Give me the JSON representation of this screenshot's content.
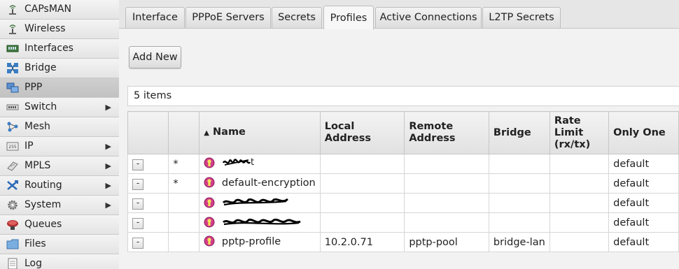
{
  "sidebar": {
    "items": [
      {
        "label": "CAPsMAN",
        "icon": "capsman-icon",
        "arrow": ""
      },
      {
        "label": "Wireless",
        "icon": "wireless-icon",
        "arrow": ""
      },
      {
        "label": "Interfaces",
        "icon": "interfaces-icon",
        "arrow": ""
      },
      {
        "label": "Bridge",
        "icon": "bridge-icon",
        "arrow": ""
      },
      {
        "label": "PPP",
        "icon": "ppp-icon",
        "arrow": ""
      },
      {
        "label": "Switch",
        "icon": "switch-icon",
        "arrow": "▶"
      },
      {
        "label": "Mesh",
        "icon": "mesh-icon",
        "arrow": ""
      },
      {
        "label": "IP",
        "icon": "ip-icon",
        "arrow": "▶"
      },
      {
        "label": "MPLS",
        "icon": "mpls-icon",
        "arrow": "▶"
      },
      {
        "label": "Routing",
        "icon": "routing-icon",
        "arrow": "▶"
      },
      {
        "label": "System",
        "icon": "system-icon",
        "arrow": "▶"
      },
      {
        "label": "Queues",
        "icon": "queues-icon",
        "arrow": ""
      },
      {
        "label": "Files",
        "icon": "files-icon",
        "arrow": ""
      },
      {
        "label": "Log",
        "icon": "log-icon",
        "arrow": ""
      }
    ],
    "active": "PPP"
  },
  "tabs": {
    "items": [
      "Interface",
      "PPPoE Servers",
      "Secrets",
      "Profiles",
      "Active Connections",
      "L2TP Secrets"
    ],
    "active": "Profiles"
  },
  "toolbar": {
    "add_new_label": "Add New"
  },
  "list": {
    "count_label": "5 items"
  },
  "table": {
    "headers": {
      "name": "Name",
      "sort_indicator": "▲",
      "local_address": "Local Address",
      "remote_address": "Remote Address",
      "bridge": "Bridge",
      "rate_limit": "Rate Limit (rx/tx)",
      "only_one": "Only One"
    },
    "rows": [
      {
        "btn": "-",
        "flag": "*",
        "name": "",
        "name_redacted": true,
        "local_address": "",
        "remote_address": "",
        "bridge": "",
        "rate_limit": "",
        "only_one": "default"
      },
      {
        "btn": "-",
        "flag": "*",
        "name": "default-encryption",
        "name_redacted": false,
        "local_address": "",
        "remote_address": "",
        "bridge": "",
        "rate_limit": "",
        "only_one": "default"
      },
      {
        "btn": "-",
        "flag": "",
        "name": "",
        "name_redacted": true,
        "local_address": "",
        "remote_address": "",
        "bridge": "",
        "rate_limit": "",
        "only_one": "default"
      },
      {
        "btn": "-",
        "flag": "",
        "name": "",
        "name_redacted": true,
        "local_address": "",
        "remote_address": "",
        "bridge": "",
        "rate_limit": "",
        "only_one": "default"
      },
      {
        "btn": "-",
        "flag": "",
        "name": "pptp-profile",
        "name_redacted": false,
        "local_address": "10.2.0.71",
        "remote_address": "pptp-pool",
        "bridge": "bridge-lan",
        "rate_limit": "",
        "only_one": "default"
      }
    ],
    "profile_icon": "profile-icon"
  }
}
